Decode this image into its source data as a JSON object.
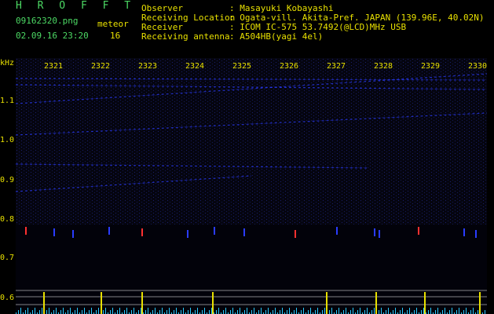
{
  "header": {
    "app_name": "H R O F F T",
    "file_name": "09162320.png",
    "detect_label": "meteor",
    "datetime": "02.09.16 23:20",
    "meteor_count": "16",
    "info_labels": [
      "Observer",
      "Receiving Location",
      "Receiver",
      "Receiving antenna"
    ],
    "info_values": [
      ": Masayuki Kobayashi",
      ": Ogata-vill. Akita-Pref. JAPAN (139.96E, 40.02N)",
      ": ICOM IC-575 53.7492(@LCD)MHz USB",
      ": A504HB(yagi 4el)"
    ]
  },
  "axes": {
    "unit": "kHz",
    "freq_ticks": [
      "1.1",
      "1.0",
      "0.9",
      "0.8",
      "0.7",
      "0.6"
    ],
    "time_ticks": [
      "2321",
      "2322",
      "2323",
      "2324",
      "2325",
      "2326",
      "2327",
      "2328",
      "2329",
      "2330"
    ]
  },
  "colors": {
    "background": "#000000",
    "label_yellow": "#e8e000",
    "label_green": "#4cd964",
    "signal_blue": "#2a3cff",
    "signal_red": "#ff3030",
    "graph_cyan": "#28c8ff"
  }
}
